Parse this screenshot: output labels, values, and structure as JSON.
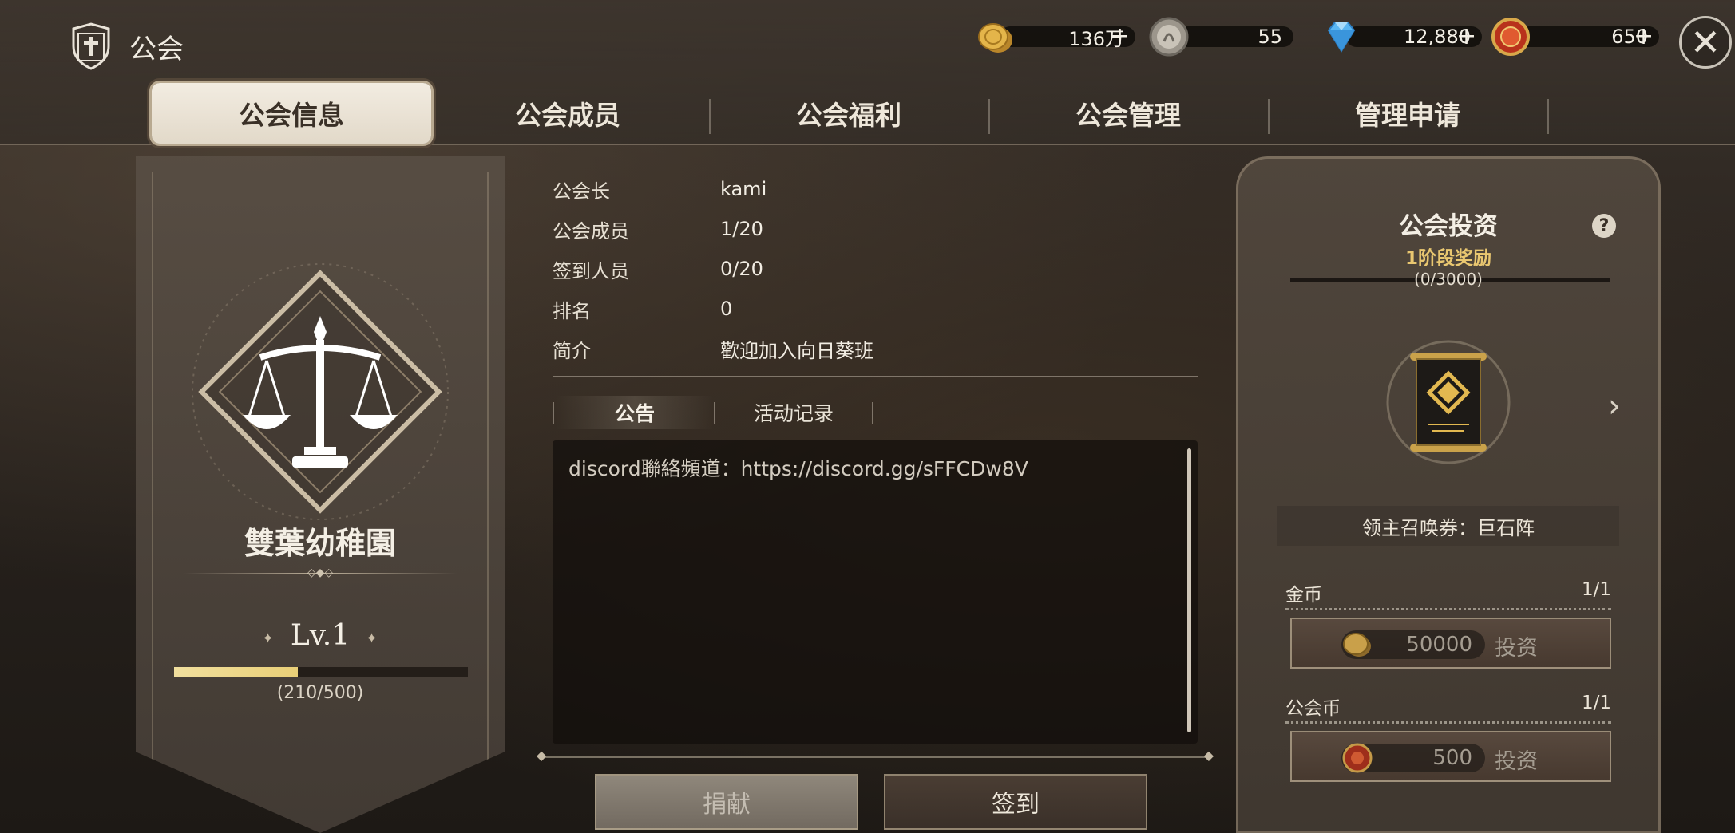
{
  "header": {
    "title": "公会",
    "close_label": "✕"
  },
  "currencies": [
    {
      "name": "gold",
      "value": "136万",
      "plus": "+",
      "color": "#d9a83c"
    },
    {
      "name": "silver",
      "value": "55",
      "plus": "",
      "color": "#b8b2a8"
    },
    {
      "name": "diamond",
      "value": "12,880",
      "plus": "+",
      "color": "#5fb4ef"
    },
    {
      "name": "guild-coin",
      "value": "650",
      "plus": "+",
      "color": "#c53a22"
    }
  ],
  "tabs": [
    "公会信息",
    "公会成员",
    "公会福利",
    "公会管理",
    "管理申请"
  ],
  "banner": {
    "guild_name": "雙葉幼稚園",
    "level": "Lv.1",
    "xp_text": "(210/500)",
    "xp_fraction": 0.42
  },
  "info": [
    {
      "label": "公会长",
      "value": "kami"
    },
    {
      "label": "公会成员",
      "value": "1/20"
    },
    {
      "label": "签到人员",
      "value": "0/20"
    },
    {
      "label": "排名",
      "value": "0"
    },
    {
      "label": "简介",
      "value": "歡迎加入向日葵班"
    }
  ],
  "subtabs": [
    "公告",
    "活动记录"
  ],
  "notice": "discord聯絡頻道：https://discord.gg/sFFCDw8V",
  "buttons": {
    "donate": "捐献",
    "signin": "签到"
  },
  "invest": {
    "title": "公会投资",
    "help": "?",
    "stage": "1阶段奖励",
    "progress": "(0/3000)",
    "reward_name": "领主召唤券：巨石阵",
    "rows": [
      {
        "label": "金币",
        "count": "1/1",
        "amount": "50000",
        "button": "投资",
        "coin_color": "#c9a04a"
      },
      {
        "label": "公会币",
        "count": "1/1",
        "amount": "500",
        "button": "投资",
        "coin_color": "#b83a22"
      }
    ]
  }
}
